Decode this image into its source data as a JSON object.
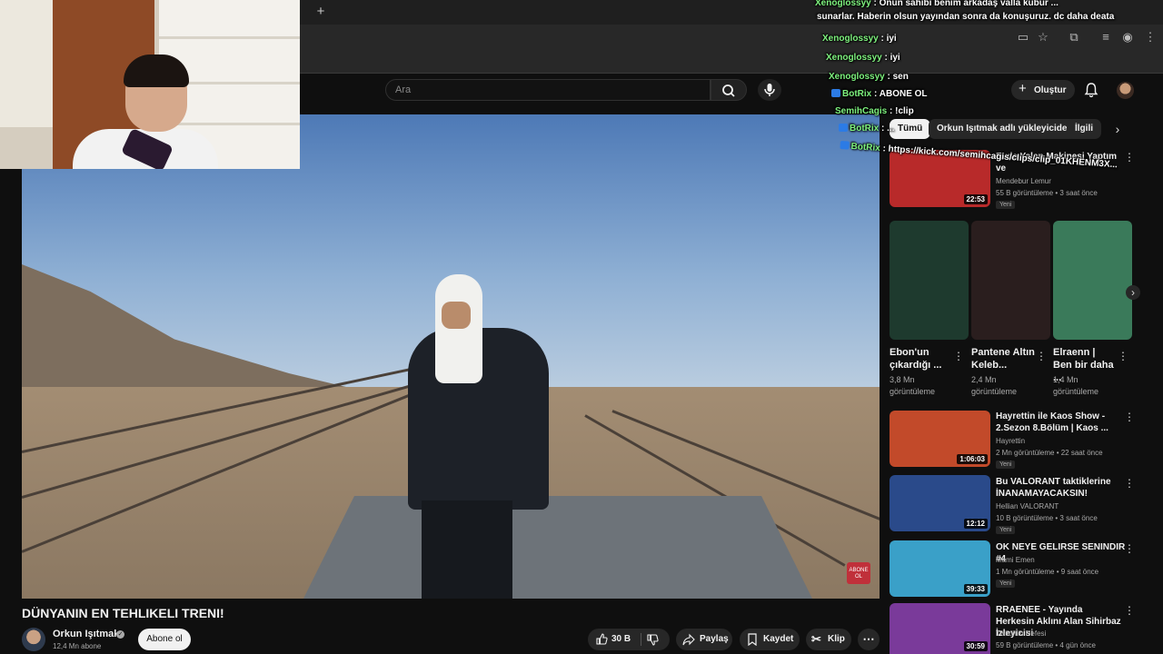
{
  "masthead": {
    "search_placeholder": "Ara",
    "create_label": "Oluştur"
  },
  "video": {
    "title": "DÜNYANIN EN TEHLIKELI TRENI!",
    "watermark": "ABONE OL",
    "channel": {
      "name": "Orkun Işıtmak",
      "subscribers": "12,4 Mn abone",
      "subscribe_label": "Abone ol"
    },
    "actions": {
      "like_count": "30 B",
      "share_label": "Paylaş",
      "save_label": "Kaydet",
      "clip_label": "Klip"
    }
  },
  "chips": [
    {
      "label": "Tümü",
      "active": true
    },
    {
      "label": "Orkun Işıtmak adlı yükleyiciden",
      "active": false
    },
    {
      "label": "İlgili",
      "active": false
    }
  ],
  "recommendations": [
    {
      "title": "Evde Yalan Makinesi Yaptım ve",
      "channel": "Mendebur Lemur",
      "meta": "55 B görüntüleme • 3 saat önce",
      "badge": "Yeni",
      "duration": "22:53",
      "thumb_color": "#b82a2a"
    },
    {
      "title": "Hayrettin ile Kaos Show - 2.Sezon 8.Bölüm | Kaos ...",
      "channel": "Hayrettin",
      "meta": "2 Mn görüntüleme • 22 saat önce",
      "badge": "Yeni",
      "duration": "1:06:03",
      "thumb_color": "#c24a2a"
    },
    {
      "title": "Bu VALORANT taktiklerine İNANAMAYACAKSIN!",
      "channel": "Hellian VALORANT",
      "meta": "10 B görüntüleme • 3 saat önce",
      "badge": "Yeni",
      "duration": "12:12",
      "thumb_color": "#2a4a8a"
    },
    {
      "title": "OK NEYE GELIRSE SENINDIR #4",
      "channel": "Mami Emen",
      "meta": "1 Mn görüntüleme • 9 saat önce",
      "badge": "Yeni",
      "duration": "39:33",
      "thumb_color": "#3aa0c8"
    },
    {
      "title": "RRAENEE - Yayında Herkesin Aklını Alan Sihirbaz İzleyicisi",
      "channel": "Twitch'in Nefesi",
      "meta": "59 B görüntüleme • 4 gün önce",
      "badge": "",
      "duration": "30:59",
      "thumb_color": "#7a3a9a"
    }
  ],
  "shorts": [
    {
      "title": "Ebon'un çıkardığı ...",
      "views": "3,8 Mn görüntüleme",
      "thumb_color": "#1e3a2e"
    },
    {
      "title": "Pantene Altın Keleb...",
      "views": "2,4 Mn görüntüleme",
      "thumb_color": "#2a1e1e"
    },
    {
      "title": "Elraenn | Ben bir daha ...",
      "views": "1,4 Mn görüntüleme",
      "thumb_color": "#3a7a5a"
    }
  ],
  "chat": [
    {
      "user": "Xenoglossyy",
      "message": ": Onun sahibi benim arkadaş valla kubur ...",
      "bot": false
    },
    {
      "user": "",
      "message": "sunarlar. Haberin olsun yayından sonra da konuşuruz. dc daha deata",
      "bot": false
    },
    {
      "user": "Xenoglossyy",
      "message": ": iyi",
      "bot": false
    },
    {
      "user": "Xenoglossyy",
      "message": ": iyi",
      "bot": false
    },
    {
      "user": "Xenoglossyy",
      "message": ": sen",
      "bot": false
    },
    {
      "user": "BotRix",
      "message": ": ABONE OL",
      "bot": true
    },
    {
      "user": "SemihCagis",
      "message": ": !clip",
      "bot": false
    },
    {
      "user": "BotRix",
      "message": ": ...",
      "bot": true
    },
    {
      "user": "BotRix",
      "message": ": https://kick.com/semihcagis/clips/clip_01KHENM3X...",
      "bot": true
    }
  ]
}
